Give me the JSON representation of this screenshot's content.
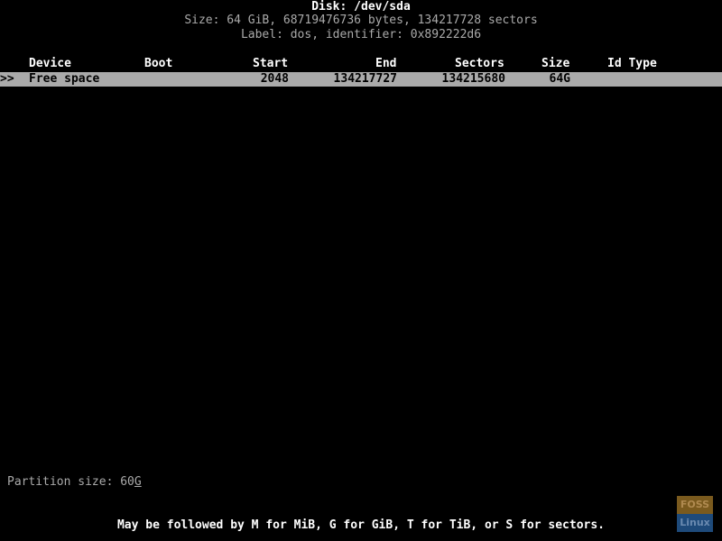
{
  "disk": {
    "title": "Disk: /dev/sda",
    "size_line": "Size: 64 GiB, 68719476736 bytes, 134217728 sectors",
    "label_line": "Label: dos, identifier: 0x892222d6"
  },
  "table": {
    "headers": {
      "device": "Device",
      "boot": "Boot",
      "start": "Start",
      "end": "End",
      "sectors": "Sectors",
      "size": "Size",
      "idtype": "Id Type"
    },
    "rows": [
      {
        "marker": ">>",
        "device": "Free space",
        "boot": "",
        "start": "2048",
        "end": "134217727",
        "sectors": "134215680",
        "size": "64G",
        "idtype": ""
      }
    ]
  },
  "prompt": {
    "label": "Partition size: ",
    "value": "60",
    "cursor_char": "G"
  },
  "hint": "May be followed by M for MiB, G for GiB, T for TiB, or S for sectors.",
  "watermark": {
    "top": "FOSS",
    "bottom": "Linux"
  }
}
